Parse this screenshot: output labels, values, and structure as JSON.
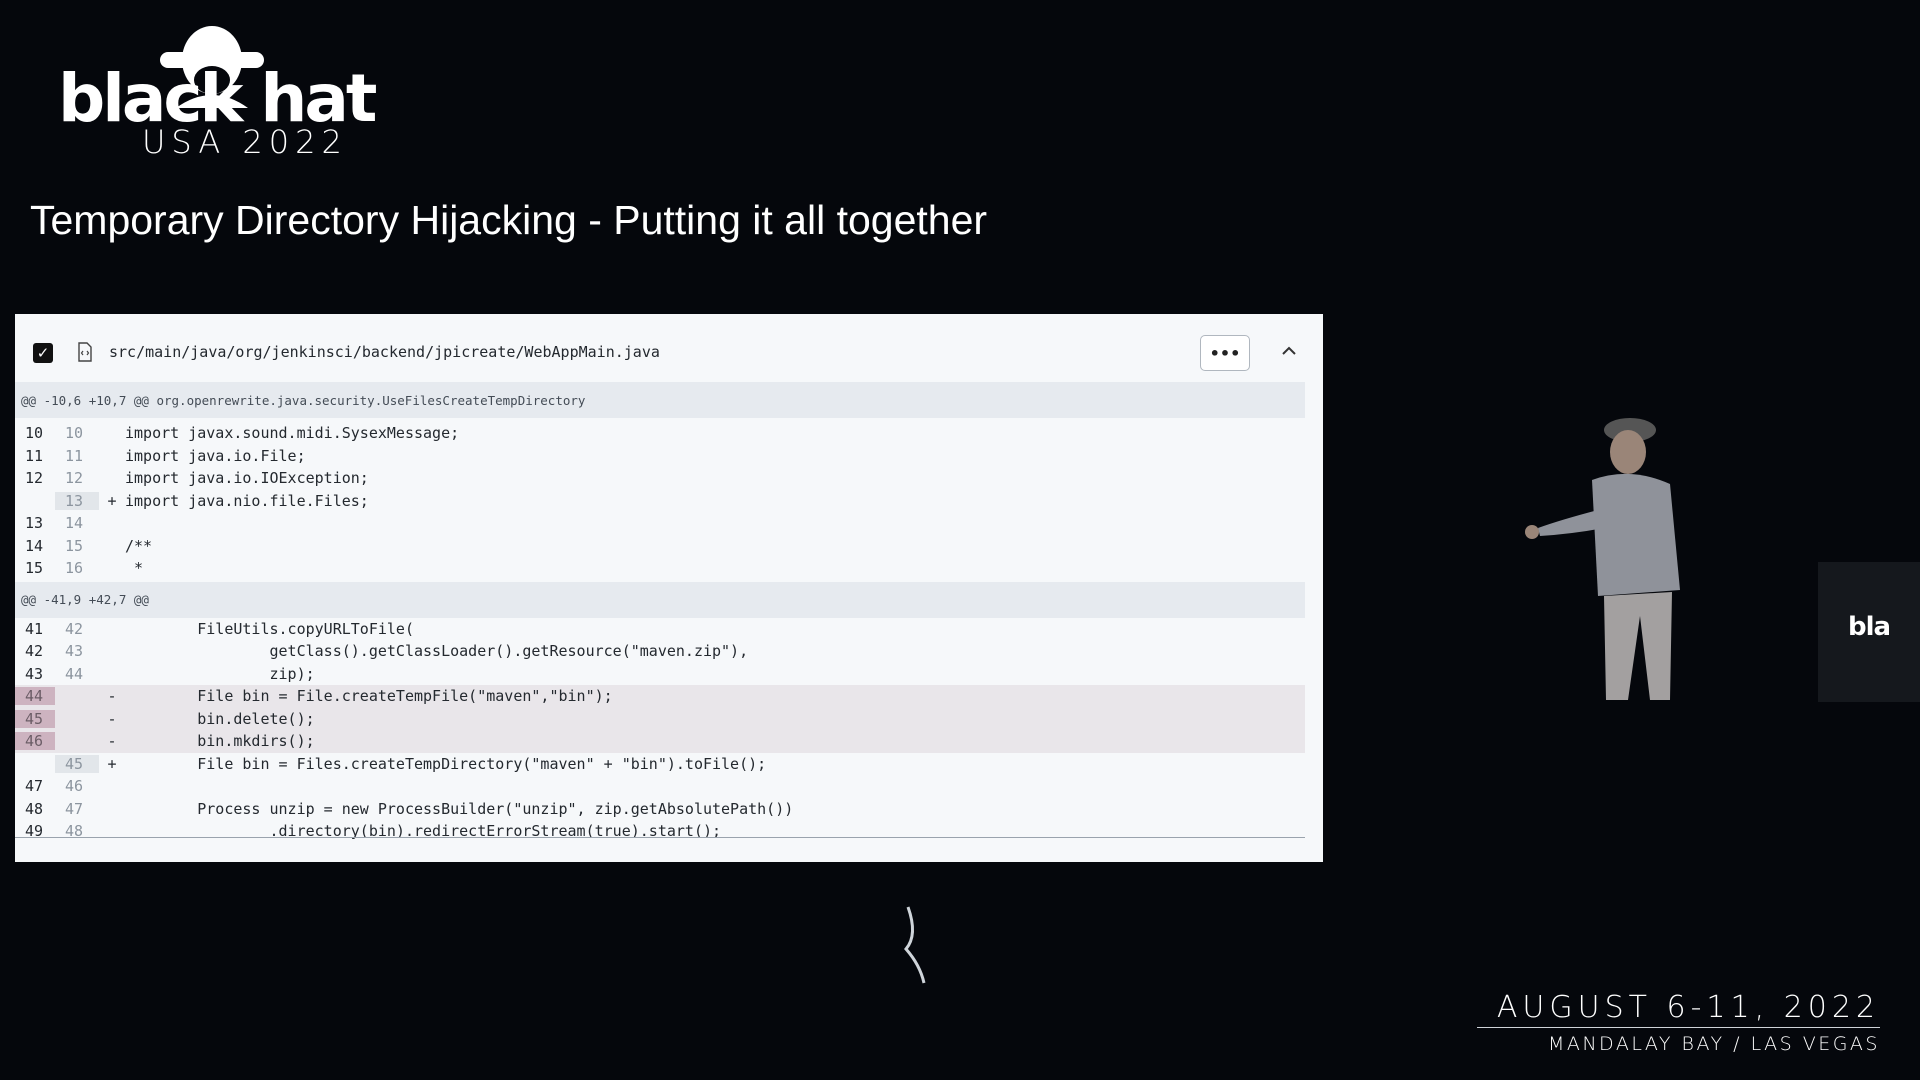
{
  "logo": {
    "word": "black hat",
    "sub": "USA 2022"
  },
  "slide": {
    "title": "Temporary Directory Hijacking - Putting it all together"
  },
  "diff": {
    "checkbox_mark": "✓",
    "file_path": "src/main/java/org/jenkinsci/backend/jpicreate/WebAppMain.java",
    "more_label": "•••",
    "hunks": [
      {
        "header": "@@ -10,6 +10,7 @@ org.openrewrite.java.security.UseFilesCreateTempDirectory",
        "lines": [
          {
            "old": "10",
            "new": "10",
            "sign": "",
            "code": "import javax.sound.midi.SysexMessage;",
            "type": "ctx"
          },
          {
            "old": "11",
            "new": "11",
            "sign": "",
            "code": "import java.io.File;",
            "type": "ctx"
          },
          {
            "old": "12",
            "new": "12",
            "sign": "",
            "code": "import java.io.IOException;",
            "type": "ctx"
          },
          {
            "old": "",
            "new": "13",
            "sign": "+",
            "code": "import java.nio.file.Files;",
            "type": "add"
          },
          {
            "old": "13",
            "new": "14",
            "sign": "",
            "code": "",
            "type": "ctx"
          },
          {
            "old": "14",
            "new": "15",
            "sign": "",
            "code": "/**",
            "type": "ctx"
          },
          {
            "old": "15",
            "new": "16",
            "sign": "",
            "code": " *",
            "type": "ctx"
          }
        ]
      },
      {
        "header": "@@ -41,9 +42,7 @@",
        "lines": [
          {
            "old": "41",
            "new": "42",
            "sign": "",
            "code": "        FileUtils.copyURLToFile(",
            "type": "ctx"
          },
          {
            "old": "42",
            "new": "43",
            "sign": "",
            "code": "                getClass().getClassLoader().getResource(\"maven.zip\"),",
            "type": "ctx"
          },
          {
            "old": "43",
            "new": "44",
            "sign": "",
            "code": "                zip);",
            "type": "ctx"
          },
          {
            "old": "44",
            "new": "",
            "sign": "-",
            "code": "        File bin = File.createTempFile(\"maven\",\"bin\");",
            "type": "del"
          },
          {
            "old": "45",
            "new": "",
            "sign": "-",
            "code": "        bin.delete();",
            "type": "del"
          },
          {
            "old": "46",
            "new": "",
            "sign": "-",
            "code": "        bin.mkdirs();",
            "type": "del"
          },
          {
            "old": "",
            "new": "45",
            "sign": "+",
            "code": "        File bin = Files.createTempDirectory(\"maven\" + \"bin\").toFile();",
            "type": "add"
          },
          {
            "old": "47",
            "new": "46",
            "sign": "",
            "code": "",
            "type": "ctx"
          },
          {
            "old": "48",
            "new": "47",
            "sign": "",
            "code": "        Process unzip = new ProcessBuilder(\"unzip\", zip.getAbsolutePath())",
            "type": "ctx"
          },
          {
            "old": "49",
            "new": "48",
            "sign": "",
            "code": "                .directory(bin).redirectErrorStream(true).start();",
            "type": "ctx"
          }
        ]
      }
    ]
  },
  "side_screen": {
    "text": "bla"
  },
  "footer": {
    "date": "AUGUST 6-11, 2022",
    "venue": "MANDALAY BAY / LAS VEGAS"
  }
}
